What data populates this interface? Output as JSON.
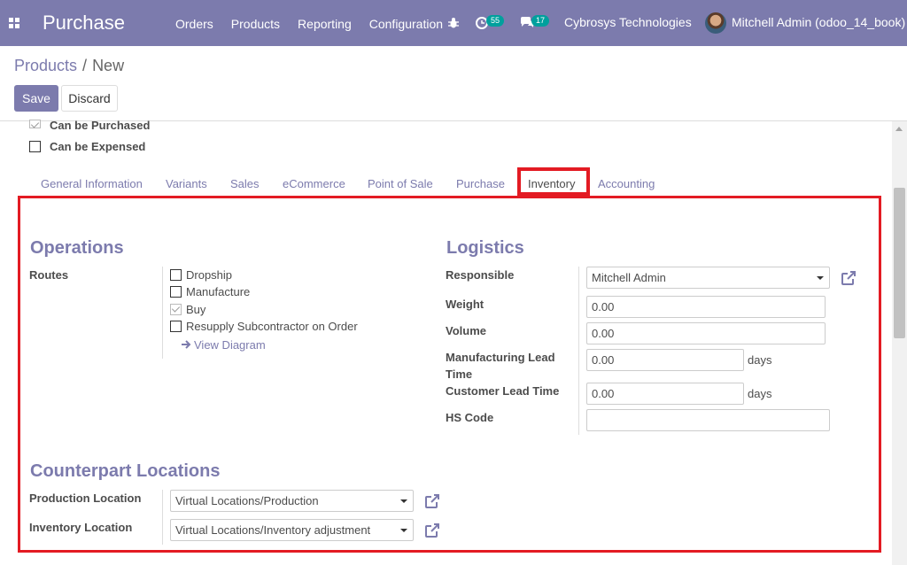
{
  "navbar": {
    "app_name": "Purchase",
    "menu": [
      "Orders",
      "Products",
      "Reporting",
      "Configuration"
    ],
    "activity_count": "55",
    "message_count": "17",
    "company": "Cybrosys Technologies",
    "user": "Mitchell Admin (odoo_14_book)"
  },
  "breadcrumb": {
    "parent": "Products",
    "separator": "/",
    "current": "New"
  },
  "buttons": {
    "save": "Save",
    "discard": "Discard"
  },
  "options": {
    "can_be_purchased": "Can be Purchased",
    "can_be_expensed": "Can be Expensed"
  },
  "tabs": [
    "General Information",
    "Variants",
    "Sales",
    "eCommerce",
    "Point of Sale",
    "Purchase",
    "Inventory",
    "Accounting"
  ],
  "active_tab": "Inventory",
  "operations": {
    "title": "Operations",
    "routes_label": "Routes",
    "routes": [
      {
        "label": "Dropship",
        "checked": false
      },
      {
        "label": "Manufacture",
        "checked": false
      },
      {
        "label": "Buy",
        "checked": true
      },
      {
        "label": "Resupply Subcontractor on Order",
        "checked": false
      }
    ],
    "view_diagram": "View Diagram"
  },
  "logistics": {
    "title": "Logistics",
    "responsible_label": "Responsible",
    "responsible_value": "Mitchell Admin",
    "weight_label": "Weight",
    "weight_value": "0.00",
    "volume_label": "Volume",
    "volume_value": "0.00",
    "mfg_lead_label_1": "Manufacturing Lead",
    "mfg_lead_label_2": "Time",
    "mfg_lead_value": "0.00",
    "mfg_lead_unit": "days",
    "customer_lead_label": "Customer Lead Time",
    "customer_lead_value": "0.00",
    "customer_lead_unit": "days",
    "hs_code_label": "HS Code",
    "hs_code_value": ""
  },
  "counterpart": {
    "title": "Counterpart Locations",
    "production_label": "Production Location",
    "production_value": "Virtual Locations/Production",
    "inventory_label": "Inventory Location",
    "inventory_value": "Virtual Locations/Inventory adjustment"
  },
  "colors": {
    "primary": "#7c7bad",
    "highlight": "#e31b23",
    "badge": "#00a09d"
  }
}
